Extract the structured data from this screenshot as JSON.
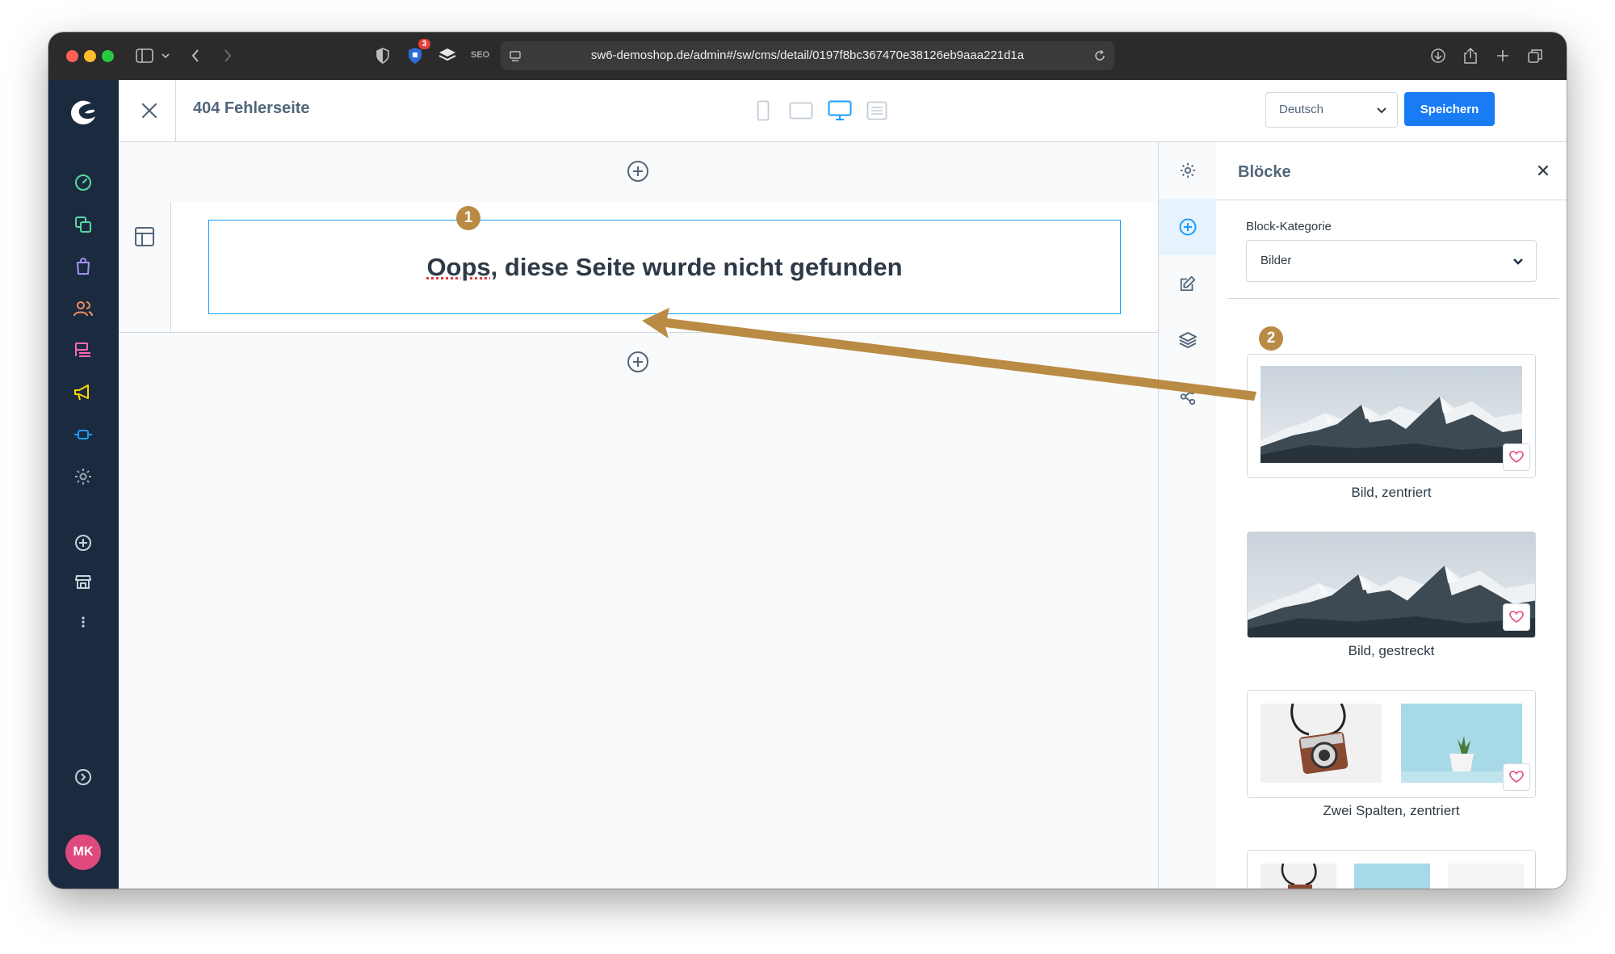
{
  "browser": {
    "url": "sw6-demoshop.de/admin#/sw/cms/detail/0197f8bc367470e38126eb9aaa221d1a",
    "extension_badge": "3",
    "seo_label": "SEO"
  },
  "user": {
    "initials": "MK"
  },
  "header": {
    "page_title": "404 Fehlerseite",
    "language": "Deutsch",
    "save_label": "Speichern"
  },
  "canvas": {
    "heading": "Oops, diese Seite wurde nicht gefunden",
    "heading_misspelled_word": "Oops",
    "heading_rest": ", diese Seite wurde nicht gefunden"
  },
  "markers": {
    "one": "1",
    "two": "2"
  },
  "panel": {
    "title": "Blöcke",
    "category_label": "Block-Kategorie",
    "category_value": "Bilder",
    "blocks": [
      {
        "label": "Bild, zentriert"
      },
      {
        "label": "Bild, gestreckt"
      },
      {
        "label": "Zwei Spalten, zentriert"
      }
    ]
  },
  "colors": {
    "accent": "#189eff",
    "save": "#1a7cf5",
    "sidebar": "#1b2b3f",
    "annotation": "#b98b45",
    "avatar": "#e0497e"
  }
}
